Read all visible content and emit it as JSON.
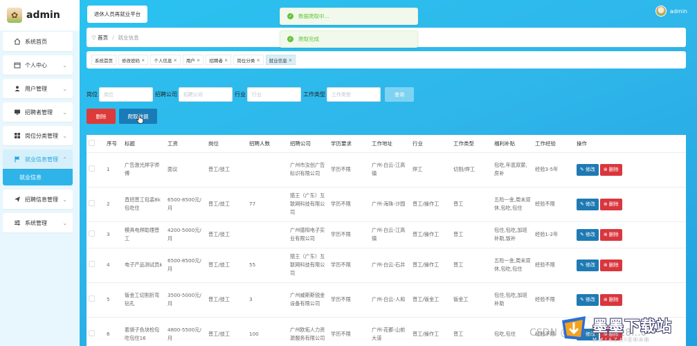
{
  "app": {
    "brand_name": "admin",
    "platform_button": "退休人员再就业平台",
    "user_name": "admin"
  },
  "sidebar": {
    "items": [
      {
        "label": "系统首页",
        "icon": "home-icon"
      },
      {
        "label": "个人中心",
        "icon": "calendar-icon"
      },
      {
        "label": "用户管理",
        "icon": "user-icon"
      },
      {
        "label": "招聘者管理",
        "icon": "monitor-icon"
      },
      {
        "label": "岗位分类管理",
        "icon": "grid-icon"
      },
      {
        "label": "就业信息管理",
        "icon": "flag-icon"
      },
      {
        "label": "招聘信息管理",
        "icon": "send-icon"
      },
      {
        "label": "系统管理",
        "icon": "sliders-icon"
      }
    ],
    "submenu_active": "就业信息"
  },
  "breadcrumb": {
    "home": "首页",
    "current": "就业信息"
  },
  "toasts": [
    {
      "text": "数据爬取中..."
    },
    {
      "text": "爬取完成"
    }
  ],
  "tags": [
    {
      "label": "系统首页",
      "closable": false
    },
    {
      "label": "修改密码",
      "closable": true
    },
    {
      "label": "个人信息",
      "closable": true
    },
    {
      "label": "用户",
      "closable": true
    },
    {
      "label": "招聘者",
      "closable": true
    },
    {
      "label": "岗位分类",
      "closable": true
    },
    {
      "label": "就业信息",
      "closable": true,
      "active": true
    }
  ],
  "filters": {
    "position_label": "岗位",
    "position_placeholder": "岗位",
    "company_label": "招聘公司",
    "company_placeholder": "招聘公司",
    "industry_label": "行业",
    "industry_placeholder": "行业",
    "worktype_label": "工作类型",
    "worktype_placeholder": "工作类型",
    "search_label": "查询"
  },
  "actions": {
    "delete_label": "删除",
    "fetch_label": "爬取数据"
  },
  "table": {
    "columns": [
      "",
      "序号",
      "标题",
      "工资",
      "岗位",
      "招聘人数",
      "招聘公司",
      "学历要求",
      "工作地址",
      "行业",
      "工作类型",
      "福利补贴",
      "工作经验",
      "操作"
    ],
    "edit_label": "修改",
    "delete_label": "删除",
    "rows": [
      {
        "id": "1",
        "title": "广告激光焊字师傅",
        "salary": "面议",
        "position": "普工/技工",
        "count": "",
        "company": "广州市汝创广告标识有限公司",
        "edu": "学历不限",
        "address": "广州-白云-江高镇",
        "industry": "焊工",
        "type": "切割/焊工",
        "benefit": "包吃,年底双薪,房补",
        "exp": "经验3-5年"
      },
      {
        "id": "2",
        "title": "直招普工包装8k包吃住",
        "salary": "6500-8500元/月",
        "position": "普工/技工",
        "count": "77",
        "company": "猎王（广东）互联网科技有限公司",
        "edu": "学历不限",
        "address": "广州-海珠-沙园",
        "industry": "普工/操作工",
        "type": "普工",
        "benefit": "五险一金,周末双休,包吃,包住",
        "exp": "经验不限"
      },
      {
        "id": "3",
        "title": "模具电焊助理普工",
        "salary": "4200-5000元/月",
        "position": "普工/技工",
        "count": "",
        "company": "广州德阳电子实业有限公司",
        "edu": "学历不限",
        "address": "广州-白云-江高镇",
        "industry": "普工/操作工",
        "type": "普工",
        "benefit": "包住,包吃,加班补助,饭补",
        "exp": "经验1-2年"
      },
      {
        "id": "4",
        "title": "电子产品测试员k",
        "salary": "6500-8500元/月",
        "position": "普工/技工",
        "count": "55",
        "company": "猎王（广东）互联网科技有限公司",
        "edu": "学历不限",
        "address": "广州-白云-石井",
        "industry": "普工/操作工",
        "type": "普工",
        "benefit": "五险一金,周末双休,包吃,包住",
        "exp": "经验不限"
      },
      {
        "id": "5",
        "title": "钣金工切割折弯钻孔",
        "salary": "3500-5000元/月",
        "position": "普工/技工",
        "count": "3",
        "company": "广州威斯斯锐金设备有限公司",
        "edu": "学历不限",
        "address": "广州-白云-人和",
        "industry": "普工/钣金工",
        "type": "钣金工",
        "benefit": "包住,包吃,加班补助",
        "exp": "经验不限"
      },
      {
        "id": "6",
        "title": "套袋子色块检包吃包住16",
        "salary": "4800-5500元/月",
        "position": "普工/技工",
        "count": "100",
        "company": "广州欧拓人力资源服务有限公司",
        "edu": "学历不限",
        "address": "广州-花都-山前大道",
        "industry": "普工/操作工",
        "type": "普工",
        "benefit": "包吃,包住",
        "exp": "经验不限"
      }
    ]
  },
  "watermark": {
    "csdn_text": "CSDN @QQ 3138918...0",
    "logo_title": "墨墨下载站",
    "logo_sub": "MMIAZAIZHAN"
  }
}
